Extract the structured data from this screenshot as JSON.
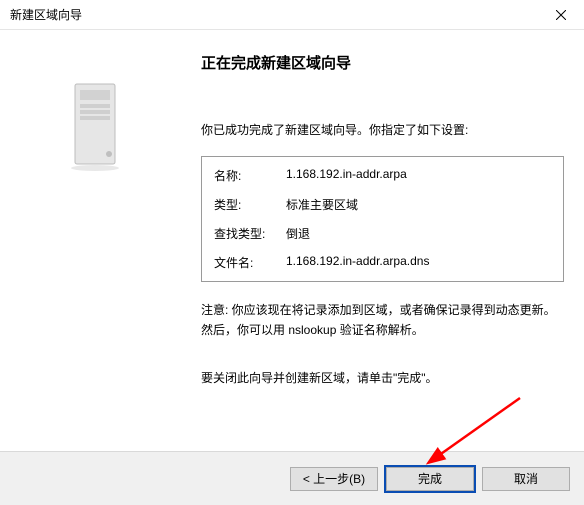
{
  "window": {
    "title": "新建区域向导"
  },
  "wizard": {
    "heading": "正在完成新建区域向导",
    "intro": "你已成功完成了新建区域向导。你指定了如下设置:",
    "settings": {
      "name_label": "名称:",
      "name_value": "1.168.192.in-addr.arpa",
      "type_label": "类型:",
      "type_value": "标准主要区域",
      "lookup_label": "查找类型:",
      "lookup_value": "倒退",
      "file_label": "文件名:",
      "file_value": "1.168.192.in-addr.arpa.dns"
    },
    "note": "注意: 你应该现在将记录添加到区域，或者确保记录得到动态更新。然后，你可以用 nslookup 验证名称解析。",
    "close_hint": "要关闭此向导并创建新区域，请单击\"完成\"。"
  },
  "buttons": {
    "back": "< 上一步(B)",
    "finish": "完成",
    "cancel": "取消"
  }
}
